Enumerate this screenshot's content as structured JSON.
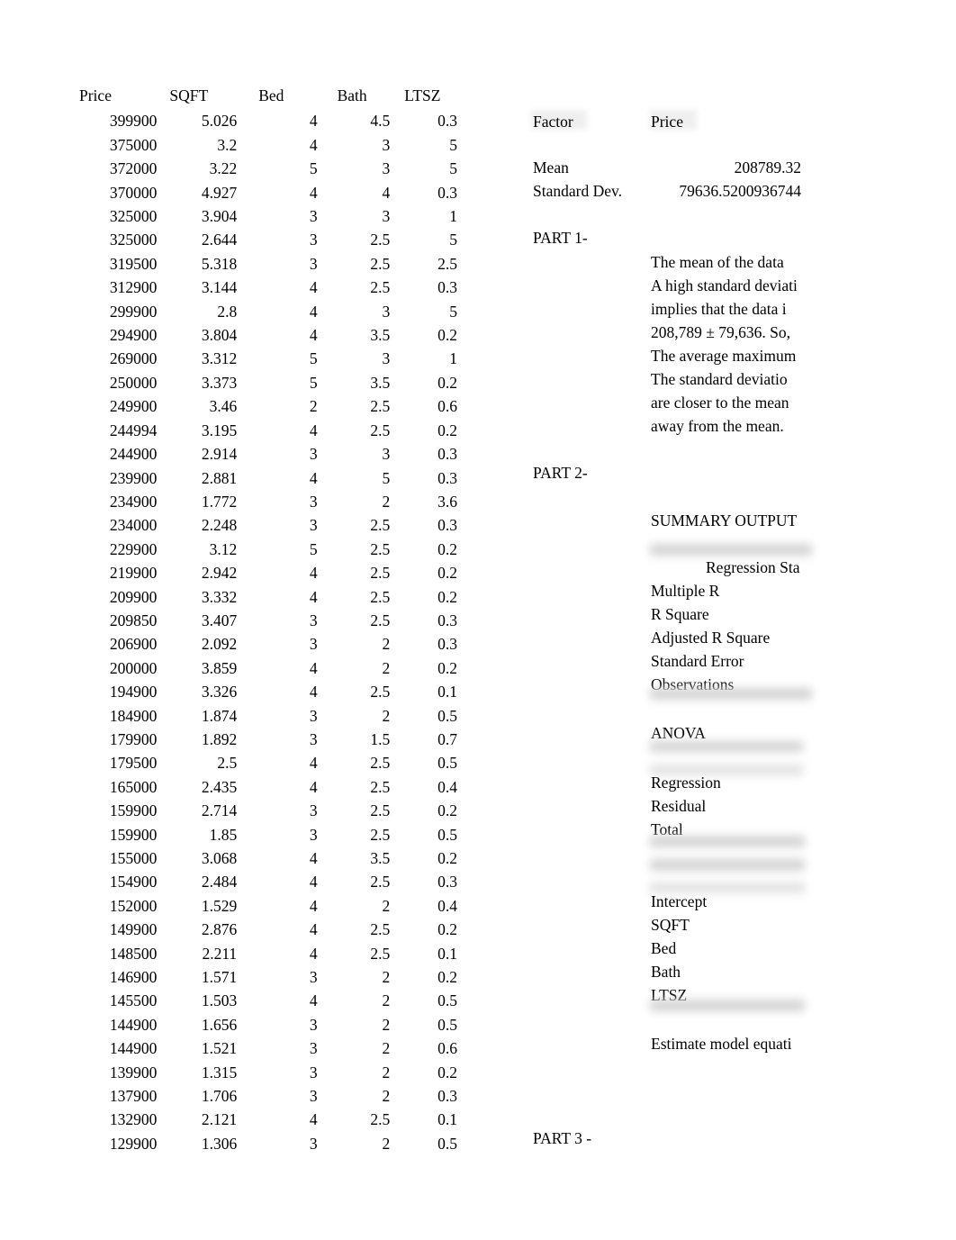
{
  "table": {
    "headers": [
      "Price",
      "SQFT",
      "Bed",
      "Bath",
      "LTSZ"
    ],
    "rows": [
      [
        "399900",
        "5.026",
        "4",
        "4.5",
        "0.3"
      ],
      [
        "375000",
        "3.2",
        "4",
        "3",
        "5"
      ],
      [
        "372000",
        "3.22",
        "5",
        "3",
        "5"
      ],
      [
        "370000",
        "4.927",
        "4",
        "4",
        "0.3"
      ],
      [
        "325000",
        "3.904",
        "3",
        "3",
        "1"
      ],
      [
        "325000",
        "2.644",
        "3",
        "2.5",
        "5"
      ],
      [
        "319500",
        "5.318",
        "3",
        "2.5",
        "2.5"
      ],
      [
        "312900",
        "3.144",
        "4",
        "2.5",
        "0.3"
      ],
      [
        "299900",
        "2.8",
        "4",
        "3",
        "5"
      ],
      [
        "294900",
        "3.804",
        "4",
        "3.5",
        "0.2"
      ],
      [
        "269000",
        "3.312",
        "5",
        "3",
        "1"
      ],
      [
        "250000",
        "3.373",
        "5",
        "3.5",
        "0.2"
      ],
      [
        "249900",
        "3.46",
        "2",
        "2.5",
        "0.6"
      ],
      [
        "244994",
        "3.195",
        "4",
        "2.5",
        "0.2"
      ],
      [
        "244900",
        "2.914",
        "3",
        "3",
        "0.3"
      ],
      [
        "239900",
        "2.881",
        "4",
        "5",
        "0.3"
      ],
      [
        "234900",
        "1.772",
        "3",
        "2",
        "3.6"
      ],
      [
        "234000",
        "2.248",
        "3",
        "2.5",
        "0.3"
      ],
      [
        "229900",
        "3.12",
        "5",
        "2.5",
        "0.2"
      ],
      [
        "219900",
        "2.942",
        "4",
        "2.5",
        "0.2"
      ],
      [
        "209900",
        "3.332",
        "4",
        "2.5",
        "0.2"
      ],
      [
        "209850",
        "3.407",
        "3",
        "2.5",
        "0.3"
      ],
      [
        "206900",
        "2.092",
        "3",
        "2",
        "0.3"
      ],
      [
        "200000",
        "3.859",
        "4",
        "2",
        "0.2"
      ],
      [
        "194900",
        "3.326",
        "4",
        "2.5",
        "0.1"
      ],
      [
        "184900",
        "1.874",
        "3",
        "2",
        "0.5"
      ],
      [
        "179900",
        "1.892",
        "3",
        "1.5",
        "0.7"
      ],
      [
        "179500",
        "2.5",
        "4",
        "2.5",
        "0.5"
      ],
      [
        "165000",
        "2.435",
        "4",
        "2.5",
        "0.4"
      ],
      [
        "159900",
        "2.714",
        "3",
        "2.5",
        "0.2"
      ],
      [
        "159900",
        "1.85",
        "3",
        "2.5",
        "0.5"
      ],
      [
        "155000",
        "3.068",
        "4",
        "3.5",
        "0.2"
      ],
      [
        "154900",
        "2.484",
        "4",
        "2.5",
        "0.3"
      ],
      [
        "152000",
        "1.529",
        "4",
        "2",
        "0.4"
      ],
      [
        "149900",
        "2.876",
        "4",
        "2.5",
        "0.2"
      ],
      [
        "148500",
        "2.211",
        "4",
        "2.5",
        "0.1"
      ],
      [
        "146900",
        "1.571",
        "3",
        "2",
        "0.2"
      ],
      [
        "145500",
        "1.503",
        "4",
        "2",
        "0.5"
      ],
      [
        "144900",
        "1.656",
        "3",
        "2",
        "0.5"
      ],
      [
        "144900",
        "1.521",
        "3",
        "2",
        "0.6"
      ],
      [
        "139900",
        "1.315",
        "3",
        "2",
        "0.2"
      ],
      [
        "137900",
        "1.706",
        "3",
        "2",
        "0.3"
      ],
      [
        "132900",
        "2.121",
        "4",
        "2.5",
        "0.1"
      ],
      [
        "129900",
        "1.306",
        "3",
        "2",
        "0.5"
      ]
    ]
  },
  "stats": {
    "factor_header": "Factor",
    "price_header": "Price",
    "mean_label": "Mean",
    "mean_value": "208789.32",
    "stdev_label": "Standard Dev.",
    "stdev_value": "79636.5200936744"
  },
  "part1": {
    "heading": "PART 1-",
    "lines": [
      "The mean of the data",
      "A high standard deviati",
      "implies that the data i",
      "208,789 ± 79,636. So,",
      "The average maximum",
      "The standard deviatio",
      "are closer to the mean",
      "away from the mean."
    ]
  },
  "part2": {
    "heading": "PART 2-",
    "summary_title": "SUMMARY OUTPUT",
    "regression_stats_header": "Regression Sta",
    "regression_stats_labels": [
      "Multiple R",
      "R Square",
      "Adjusted R Square",
      "Standard Error",
      "Observations"
    ],
    "anova_title": "ANOVA",
    "anova_labels": [
      "Regression",
      "Residual",
      "Total"
    ],
    "coefficient_labels": [
      "Intercept",
      "SQFT",
      "Bed",
      "Bath",
      "LTSZ"
    ],
    "estimate_note": "Estimate model equati"
  },
  "part3": {
    "heading": "PART 3 -"
  }
}
